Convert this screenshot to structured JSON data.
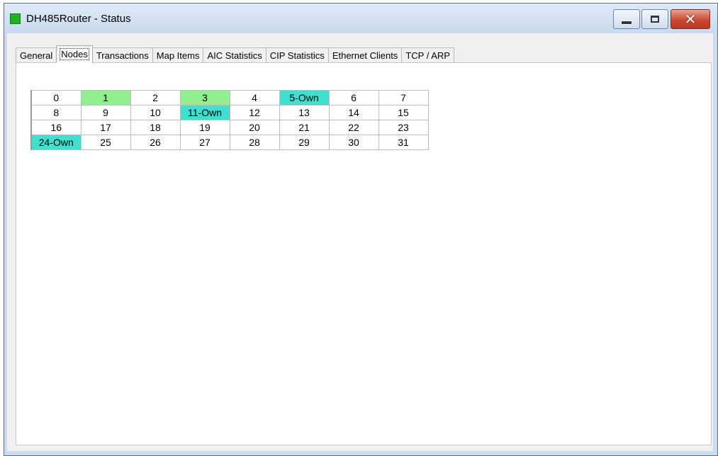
{
  "window": {
    "title": "DH485Router - Status",
    "icon": "green-square-app-icon",
    "controls": [
      "minimize",
      "maximize",
      "close"
    ]
  },
  "tabs": [
    {
      "label": "General",
      "active": false
    },
    {
      "label": "Nodes",
      "active": true
    },
    {
      "label": "Transactions",
      "active": false
    },
    {
      "label": "Map Items",
      "active": false
    },
    {
      "label": "AIC Statistics",
      "active": false
    },
    {
      "label": "CIP Statistics",
      "active": false
    },
    {
      "label": "Ethernet Clients",
      "active": false
    },
    {
      "label": "TCP / ARP",
      "active": false
    }
  ],
  "colors": {
    "active_node": "#90ee90",
    "own_node": "#40e0d0",
    "close_button": "#c94a32"
  },
  "nodes": {
    "rows": [
      [
        {
          "text": "0",
          "state": "none"
        },
        {
          "text": "1",
          "state": "active"
        },
        {
          "text": "2",
          "state": "none"
        },
        {
          "text": "3",
          "state": "active"
        },
        {
          "text": "4",
          "state": "none"
        },
        {
          "text": "5-Own",
          "state": "own"
        },
        {
          "text": "6",
          "state": "none"
        },
        {
          "text": "7",
          "state": "none"
        }
      ],
      [
        {
          "text": "8",
          "state": "none"
        },
        {
          "text": "9",
          "state": "none"
        },
        {
          "text": "10",
          "state": "none"
        },
        {
          "text": "11-Own",
          "state": "own"
        },
        {
          "text": "12",
          "state": "none"
        },
        {
          "text": "13",
          "state": "none"
        },
        {
          "text": "14",
          "state": "none"
        },
        {
          "text": "15",
          "state": "none"
        }
      ],
      [
        {
          "text": "16",
          "state": "none"
        },
        {
          "text": "17",
          "state": "none"
        },
        {
          "text": "18",
          "state": "none"
        },
        {
          "text": "19",
          "state": "none"
        },
        {
          "text": "20",
          "state": "none"
        },
        {
          "text": "21",
          "state": "none"
        },
        {
          "text": "22",
          "state": "none"
        },
        {
          "text": "23",
          "state": "none"
        }
      ],
      [
        {
          "text": "24-Own",
          "state": "own"
        },
        {
          "text": "25",
          "state": "none"
        },
        {
          "text": "26",
          "state": "none"
        },
        {
          "text": "27",
          "state": "none"
        },
        {
          "text": "28",
          "state": "none"
        },
        {
          "text": "29",
          "state": "none"
        },
        {
          "text": "30",
          "state": "none"
        },
        {
          "text": "31",
          "state": "none"
        }
      ]
    ]
  }
}
